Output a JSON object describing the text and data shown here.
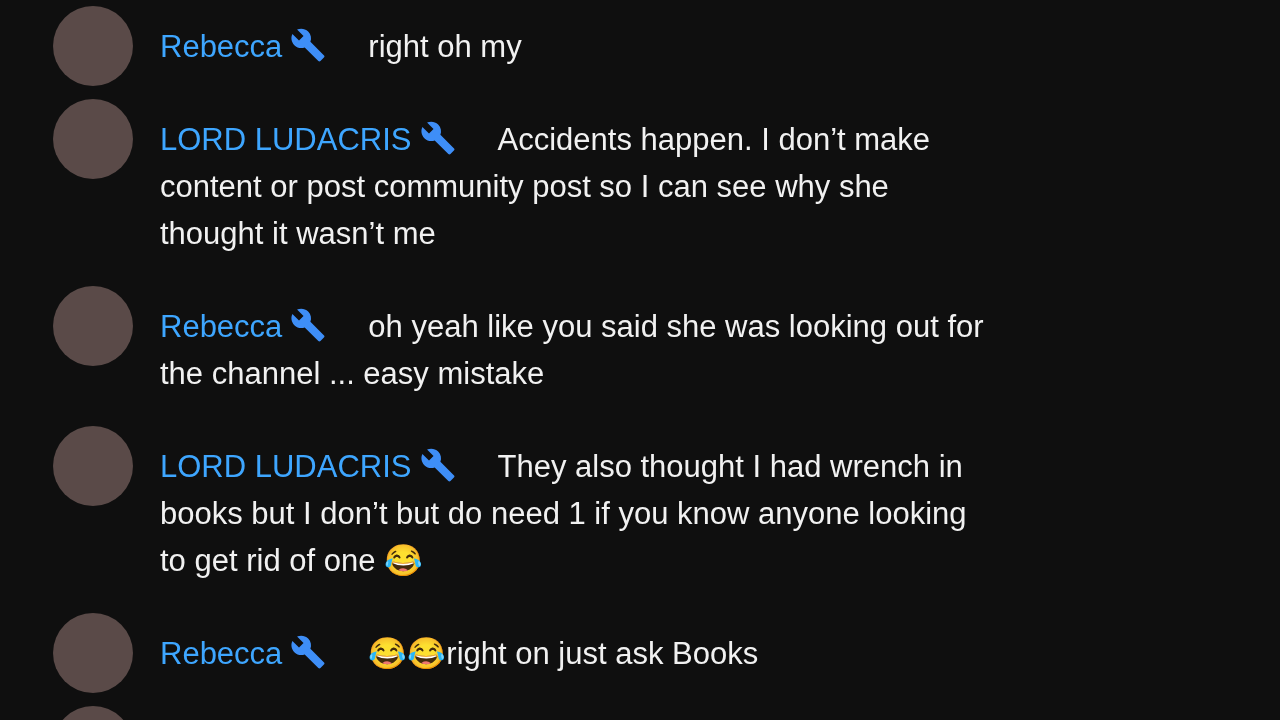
{
  "chat_messages": [
    {
      "kind": "message",
      "author": "Rebecca",
      "lines": [
        "right oh my"
      ]
    },
    {
      "kind": "message",
      "author": "LORD LUDACRIS",
      "lines": [
        "Accidents happen. I don’t make",
        "content or post community post so I can see why she",
        "thought it wasn’t me"
      ]
    },
    {
      "kind": "message",
      "author": "Rebecca",
      "lines": [
        "oh yeah like you said she was looking out for",
        "the channel ... easy mistake"
      ]
    },
    {
      "kind": "message",
      "author": "LORD LUDACRIS",
      "lines": [
        "They also thought I had wrench in",
        "books but I don’t but do need 1 if you know anyone looking",
        "to get rid of one 😂"
      ]
    },
    {
      "kind": "message",
      "author": "Rebecca",
      "lines": [
        "😂😂right on just ask Books"
      ]
    },
    {
      "kind": "partial"
    }
  ]
}
